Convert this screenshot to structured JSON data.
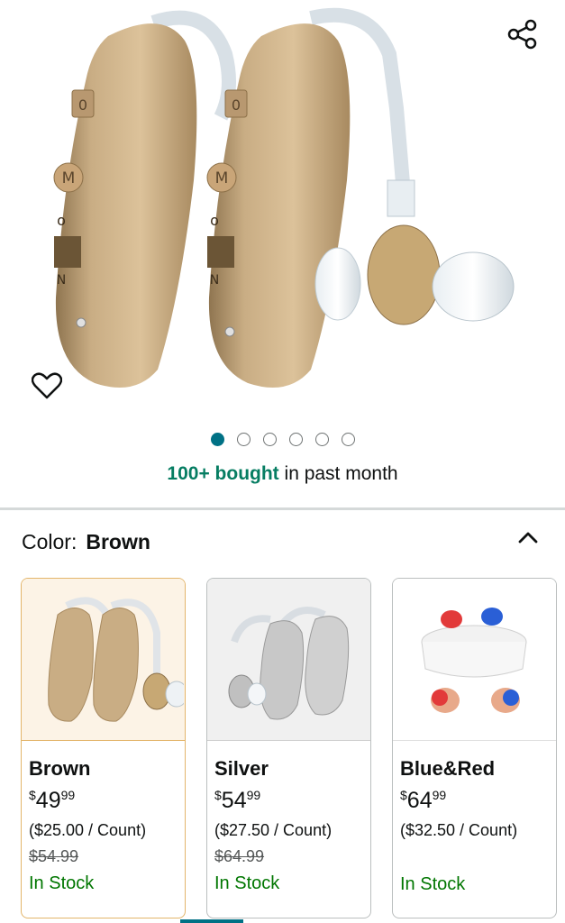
{
  "hero": {
    "image_icon": "hearing-aids-product-image",
    "share_icon": "share-icon",
    "favorite_icon": "heart-icon",
    "image_count": 6,
    "active_image": 1,
    "device_labels": {
      "switch_top": "0",
      "button": "M",
      "dial_o": "o",
      "dial_n": "N"
    }
  },
  "social_proof": {
    "bought": "100+ bought",
    "suffix": " in past month"
  },
  "color": {
    "label": "Color:",
    "value": "Brown",
    "collapse_icon": "chevron-up-icon"
  },
  "swatches": [
    {
      "name": "Brown",
      "currency": "$",
      "whole": "49",
      "fraction": "99",
      "per_count": "($25.00 / Count)",
      "list_price": "$54.99",
      "stock": "In Stock",
      "selected": true
    },
    {
      "name": "Silver",
      "currency": "$",
      "whole": "54",
      "fraction": "99",
      "per_count": "($27.50 / Count)",
      "list_price": "$64.99",
      "stock": "In Stock",
      "selected": false
    },
    {
      "name": "Blue&Red",
      "currency": "$",
      "whole": "64",
      "fraction": "99",
      "per_count": "($32.50 / Count)",
      "list_price": "",
      "stock": "In Stock",
      "selected": false
    }
  ],
  "colors": {
    "accent": "#007185",
    "deal_green": "#067d62",
    "stock_green": "#007600",
    "selected_border": "#e3b56b",
    "product_gold": "#c9ad84"
  }
}
